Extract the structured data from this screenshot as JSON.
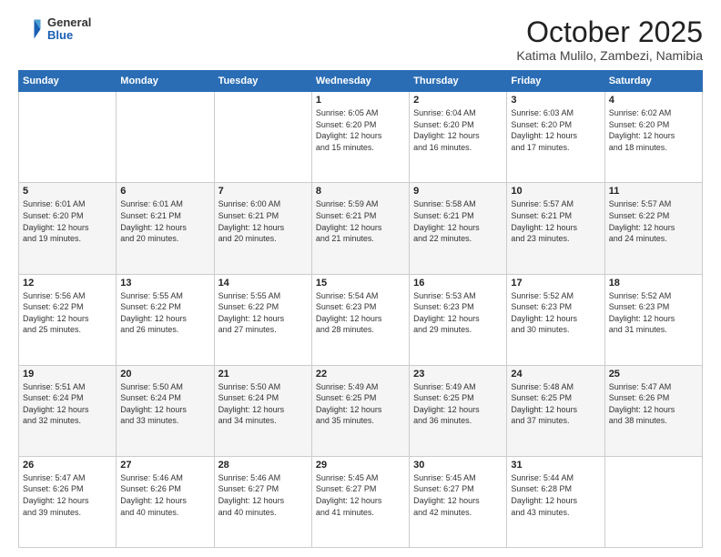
{
  "header": {
    "logo_general": "General",
    "logo_blue": "Blue",
    "month": "October 2025",
    "location": "Katima Mulilo, Zambezi, Namibia"
  },
  "weekdays": [
    "Sunday",
    "Monday",
    "Tuesday",
    "Wednesday",
    "Thursday",
    "Friday",
    "Saturday"
  ],
  "weeks": [
    [
      {
        "day": "",
        "info": ""
      },
      {
        "day": "",
        "info": ""
      },
      {
        "day": "",
        "info": ""
      },
      {
        "day": "1",
        "info": "Sunrise: 6:05 AM\nSunset: 6:20 PM\nDaylight: 12 hours\nand 15 minutes."
      },
      {
        "day": "2",
        "info": "Sunrise: 6:04 AM\nSunset: 6:20 PM\nDaylight: 12 hours\nand 16 minutes."
      },
      {
        "day": "3",
        "info": "Sunrise: 6:03 AM\nSunset: 6:20 PM\nDaylight: 12 hours\nand 17 minutes."
      },
      {
        "day": "4",
        "info": "Sunrise: 6:02 AM\nSunset: 6:20 PM\nDaylight: 12 hours\nand 18 minutes."
      }
    ],
    [
      {
        "day": "5",
        "info": "Sunrise: 6:01 AM\nSunset: 6:20 PM\nDaylight: 12 hours\nand 19 minutes."
      },
      {
        "day": "6",
        "info": "Sunrise: 6:01 AM\nSunset: 6:21 PM\nDaylight: 12 hours\nand 20 minutes."
      },
      {
        "day": "7",
        "info": "Sunrise: 6:00 AM\nSunset: 6:21 PM\nDaylight: 12 hours\nand 20 minutes."
      },
      {
        "day": "8",
        "info": "Sunrise: 5:59 AM\nSunset: 6:21 PM\nDaylight: 12 hours\nand 21 minutes."
      },
      {
        "day": "9",
        "info": "Sunrise: 5:58 AM\nSunset: 6:21 PM\nDaylight: 12 hours\nand 22 minutes."
      },
      {
        "day": "10",
        "info": "Sunrise: 5:57 AM\nSunset: 6:21 PM\nDaylight: 12 hours\nand 23 minutes."
      },
      {
        "day": "11",
        "info": "Sunrise: 5:57 AM\nSunset: 6:22 PM\nDaylight: 12 hours\nand 24 minutes."
      }
    ],
    [
      {
        "day": "12",
        "info": "Sunrise: 5:56 AM\nSunset: 6:22 PM\nDaylight: 12 hours\nand 25 minutes."
      },
      {
        "day": "13",
        "info": "Sunrise: 5:55 AM\nSunset: 6:22 PM\nDaylight: 12 hours\nand 26 minutes."
      },
      {
        "day": "14",
        "info": "Sunrise: 5:55 AM\nSunset: 6:22 PM\nDaylight: 12 hours\nand 27 minutes."
      },
      {
        "day": "15",
        "info": "Sunrise: 5:54 AM\nSunset: 6:23 PM\nDaylight: 12 hours\nand 28 minutes."
      },
      {
        "day": "16",
        "info": "Sunrise: 5:53 AM\nSunset: 6:23 PM\nDaylight: 12 hours\nand 29 minutes."
      },
      {
        "day": "17",
        "info": "Sunrise: 5:52 AM\nSunset: 6:23 PM\nDaylight: 12 hours\nand 30 minutes."
      },
      {
        "day": "18",
        "info": "Sunrise: 5:52 AM\nSunset: 6:23 PM\nDaylight: 12 hours\nand 31 minutes."
      }
    ],
    [
      {
        "day": "19",
        "info": "Sunrise: 5:51 AM\nSunset: 6:24 PM\nDaylight: 12 hours\nand 32 minutes."
      },
      {
        "day": "20",
        "info": "Sunrise: 5:50 AM\nSunset: 6:24 PM\nDaylight: 12 hours\nand 33 minutes."
      },
      {
        "day": "21",
        "info": "Sunrise: 5:50 AM\nSunset: 6:24 PM\nDaylight: 12 hours\nand 34 minutes."
      },
      {
        "day": "22",
        "info": "Sunrise: 5:49 AM\nSunset: 6:25 PM\nDaylight: 12 hours\nand 35 minutes."
      },
      {
        "day": "23",
        "info": "Sunrise: 5:49 AM\nSunset: 6:25 PM\nDaylight: 12 hours\nand 36 minutes."
      },
      {
        "day": "24",
        "info": "Sunrise: 5:48 AM\nSunset: 6:25 PM\nDaylight: 12 hours\nand 37 minutes."
      },
      {
        "day": "25",
        "info": "Sunrise: 5:47 AM\nSunset: 6:26 PM\nDaylight: 12 hours\nand 38 minutes."
      }
    ],
    [
      {
        "day": "26",
        "info": "Sunrise: 5:47 AM\nSunset: 6:26 PM\nDaylight: 12 hours\nand 39 minutes."
      },
      {
        "day": "27",
        "info": "Sunrise: 5:46 AM\nSunset: 6:26 PM\nDaylight: 12 hours\nand 40 minutes."
      },
      {
        "day": "28",
        "info": "Sunrise: 5:46 AM\nSunset: 6:27 PM\nDaylight: 12 hours\nand 40 minutes."
      },
      {
        "day": "29",
        "info": "Sunrise: 5:45 AM\nSunset: 6:27 PM\nDaylight: 12 hours\nand 41 minutes."
      },
      {
        "day": "30",
        "info": "Sunrise: 5:45 AM\nSunset: 6:27 PM\nDaylight: 12 hours\nand 42 minutes."
      },
      {
        "day": "31",
        "info": "Sunrise: 5:44 AM\nSunset: 6:28 PM\nDaylight: 12 hours\nand 43 minutes."
      },
      {
        "day": "",
        "info": ""
      }
    ]
  ]
}
